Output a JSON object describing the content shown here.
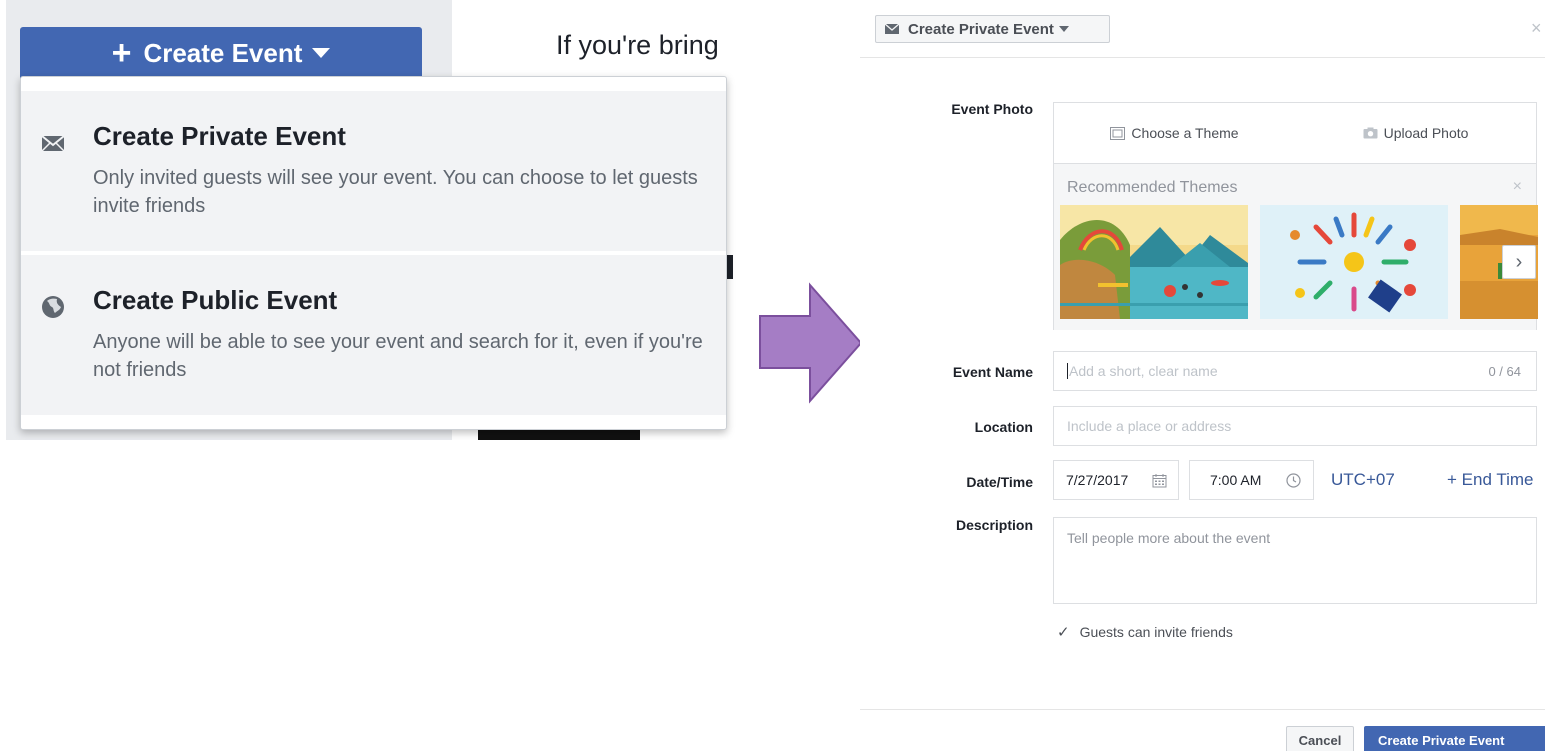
{
  "left_panel": {
    "create_button": {
      "plus": "+",
      "label": "Create Event"
    },
    "right_heading": "If you're bring",
    "menu_items": [
      {
        "icon": "envelope-icon",
        "title": "Create Private Event",
        "description": "Only invited guests will see your event. You can choose to let guests invite friends"
      },
      {
        "icon": "globe-icon",
        "title": "Create Public Event",
        "description": "Anyone will be able to see your event and search for it, even if you're not friends"
      }
    ]
  },
  "arrow": {
    "color": "#a57dc5",
    "border": "#7b4f9d"
  },
  "dialog": {
    "type_select": "Create Private Event",
    "close": "×",
    "event_photo": {
      "label": "Event Photo",
      "tab_theme": "Choose a Theme",
      "tab_upload": "Upload Photo",
      "recommended_title": "Recommended Themes",
      "recommended_close": "×",
      "next": "›"
    },
    "event_name": {
      "label": "Event Name",
      "placeholder": "Add a short, clear name",
      "counter": "0 / 64"
    },
    "location": {
      "label": "Location",
      "placeholder": "Include a place or address"
    },
    "datetime": {
      "label": "Date/Time",
      "date": "7/27/2017",
      "time": "7:00 AM",
      "timezone": "UTC+07",
      "end_time": "+ End Time"
    },
    "description": {
      "label": "Description",
      "placeholder": "Tell people more about the event"
    },
    "guests_invite": {
      "checked": true,
      "mark": "✓",
      "label": "Guests can invite friends"
    },
    "footer": {
      "cancel": "Cancel",
      "create": "Create Private Event"
    }
  },
  "colors": {
    "brand_blue": "#4267b2",
    "link_blue": "#385898"
  }
}
